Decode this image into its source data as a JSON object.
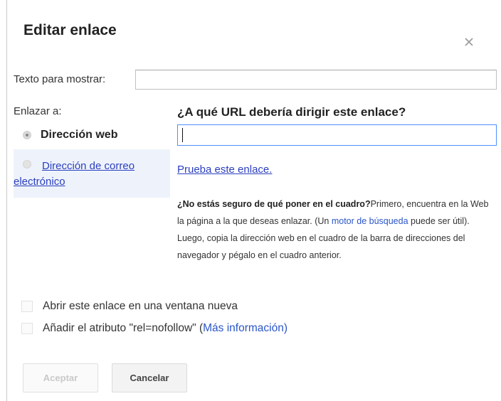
{
  "dialog": {
    "title": "Editar enlace",
    "close_icon": "close-icon"
  },
  "display_text": {
    "label": "Texto para mostrar:",
    "value": ""
  },
  "link_to": {
    "label": "Enlazar a:",
    "options": [
      {
        "label": "Dirección web",
        "selected": true
      },
      {
        "label": "Dirección de correo electrónico",
        "selected": false
      }
    ]
  },
  "url": {
    "question": "¿A qué URL debería dirigir este enlace?",
    "value": "",
    "test_link": "Prueba este enlace."
  },
  "help": {
    "bold": "¿No estás seguro de qué poner en el cuadro?",
    "text1": "Primero, encuentra en la Web la página a la que deseas enlazar. (Un ",
    "link": "motor de búsqueda",
    "text2": " puede ser útil). Luego, copia la dirección web en el cuadro de la barra de direcciones del navegador y pégalo en el cuadro anterior."
  },
  "options": {
    "new_window_label": "Abrir este enlace en una ventana nueva",
    "new_window_checked": false,
    "nofollow_label": "Añadir el atributo \"rel=nofollow\" (",
    "nofollow_link": "Más información",
    "nofollow_close": ")",
    "nofollow_checked": false
  },
  "buttons": {
    "ok": "Aceptar",
    "cancel": "Cancelar"
  },
  "colors": {
    "link": "#2b3fbf",
    "focus_border": "#4d90fe",
    "options_panel": "#eef3fb"
  }
}
